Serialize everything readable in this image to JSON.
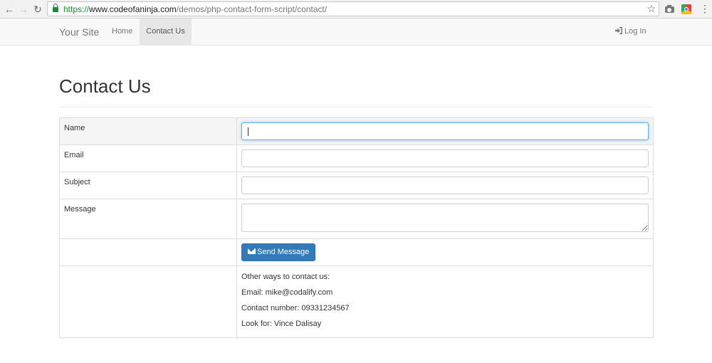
{
  "browser": {
    "url_scheme": "https://",
    "url_host": "www.codeofaninja.com",
    "url_path": "/demos/php-contact-form-script/contact/",
    "back_icon": "arrow-left",
    "forward_icon": "arrow-right",
    "reload_icon": "reload",
    "bookmark_icon": "star"
  },
  "navbar": {
    "brand": "Your Site",
    "home": "Home",
    "contact": "Contact Us",
    "login": "Log In"
  },
  "page": {
    "title": "Contact Us"
  },
  "form": {
    "name_label": "Name",
    "email_label": "Email",
    "subject_label": "Subject",
    "message_label": "Message",
    "name_value": "",
    "email_value": "",
    "subject_value": "",
    "message_value": "",
    "send_label": "Send Message"
  },
  "info": {
    "heading": "Other ways to contact us:",
    "email": "Email: mike@codalify.com",
    "phone": "Contact number: 09331234567",
    "look_for": "Look for: Vince Dalisay"
  },
  "colors": {
    "primary": "#337ab7",
    "secure_green": "#1a8b3a",
    "focus_border": "#66afe9"
  }
}
